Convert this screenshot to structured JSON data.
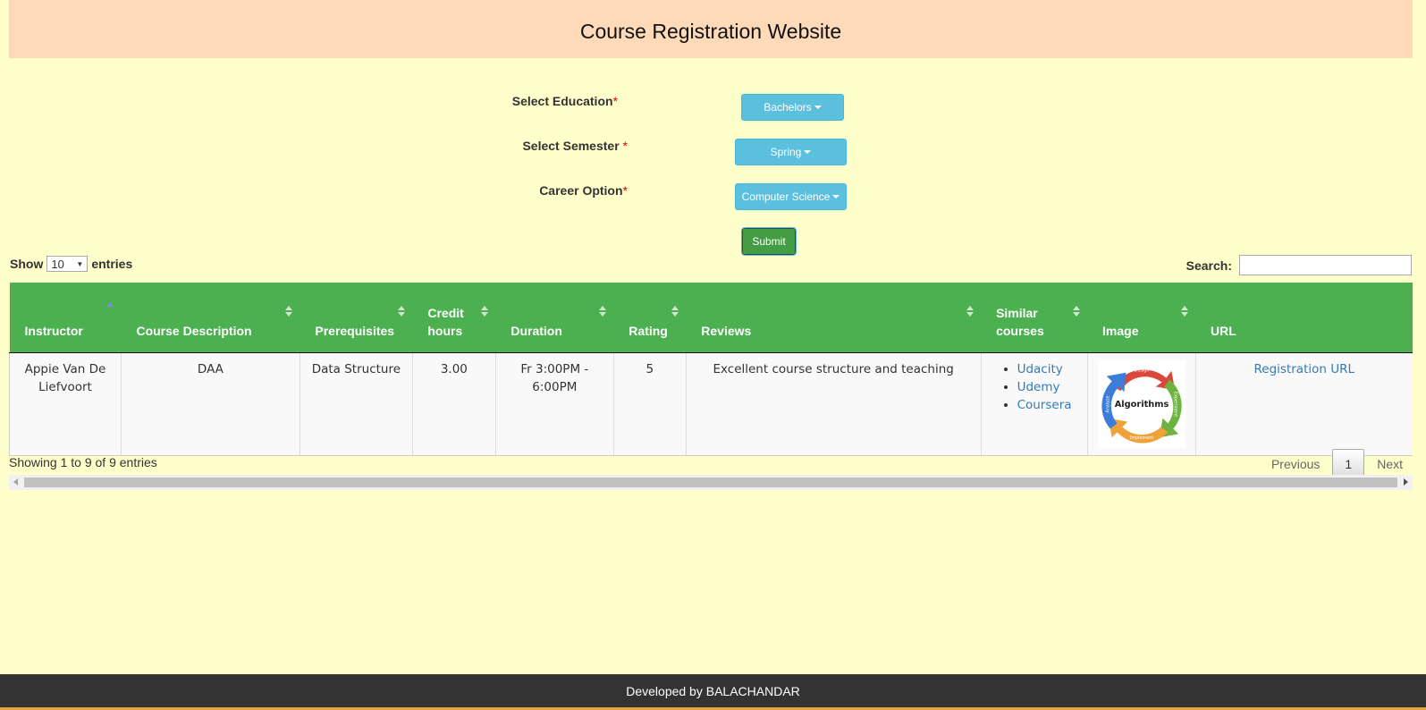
{
  "header": {
    "title": "Course Registration Website"
  },
  "form": {
    "education_label": "Select Education",
    "education_value": "Bachelors",
    "semester_label": "Select Semester ",
    "semester_value": "Spring",
    "career_label": "Career Option",
    "career_value": "Computer Science",
    "required_mark": "*",
    "submit_label": "Submit"
  },
  "table_controls": {
    "show_label": "Show",
    "entries_value": "10",
    "entries_label": "entries",
    "search_label": "Search:",
    "search_value": ""
  },
  "table": {
    "columns": [
      "Instructor",
      "Course Description",
      "Prerequisites",
      "Credit hours",
      "Duration",
      "Rating",
      "Reviews",
      "Similar courses",
      "Image",
      "URL"
    ],
    "rows": [
      {
        "instructor": "Appie Van De Liefvoort",
        "course_description": "DAA",
        "prerequisites": "Data Structure",
        "credit_hours": "3.00",
        "duration": "Fr 3:00PM - 6:00PM",
        "rating": "5",
        "reviews": "Excellent course structure and teaching",
        "similar_courses": [
          "Udacity",
          "Udemy",
          "Coursera"
        ],
        "image_text": {
          "center": "Algorithms",
          "design": "Design",
          "experiment": "Experiment",
          "implement": "Implement",
          "analyze": "Analyze"
        },
        "url_label": "Registration URL"
      }
    ]
  },
  "footer_info": {
    "showing": "Showing 1 to 9 of 9 entries",
    "previous": "Previous",
    "page": "1",
    "next": "Next"
  },
  "footer": {
    "text": "Developed by BALACHANDAR"
  },
  "colors": {
    "page_bg": "#ffffcc",
    "header_bg": "#ffdab9",
    "table_header": "#4caf50",
    "dropdown_btn": "#5bc0de",
    "submit_btn": "#449d44",
    "footer_bg": "#333333",
    "link": "#337ab7"
  }
}
